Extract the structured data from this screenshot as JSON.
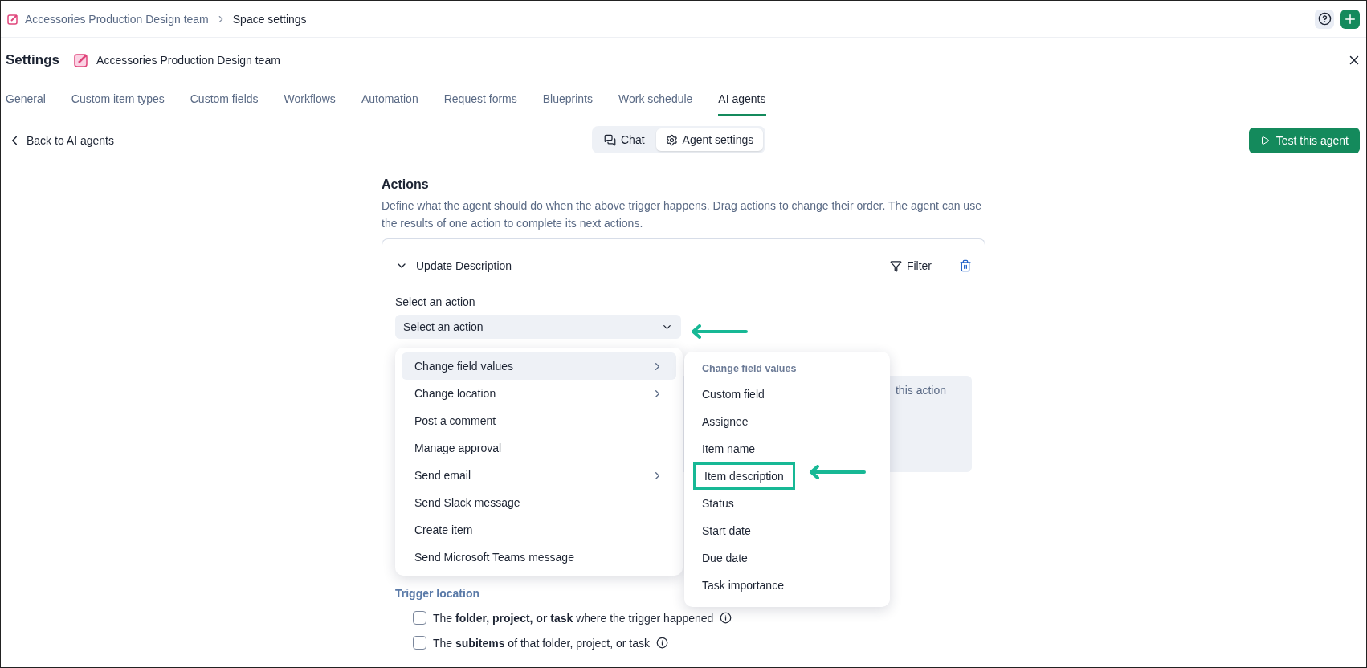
{
  "breadcrumb": [
    {
      "label": "Accessories Production Design team",
      "kind": "link"
    },
    {
      "label": "Space settings",
      "kind": "current"
    }
  ],
  "header": {
    "title": "Settings",
    "space_name": "Accessories Production Design team"
  },
  "tabs": [
    {
      "label": "General",
      "selected": false
    },
    {
      "label": "Custom item types",
      "selected": false
    },
    {
      "label": "Custom fields",
      "selected": false
    },
    {
      "label": "Workflows",
      "selected": false
    },
    {
      "label": "Automation",
      "selected": false
    },
    {
      "label": "Request forms",
      "selected": false
    },
    {
      "label": "Blueprints",
      "selected": false
    },
    {
      "label": "Work schedule",
      "selected": false
    },
    {
      "label": "AI agents",
      "selected": true
    }
  ],
  "back_link": "Back to AI agents",
  "view_toggle": [
    {
      "label": "Chat",
      "kind": "chat",
      "selected": false
    },
    {
      "label": "Agent settings",
      "kind": "settings",
      "selected": true
    }
  ],
  "test_button": "Test this agent",
  "actions": {
    "title": "Actions",
    "description": "Define what the agent should do when the above trigger happens. Drag actions to change their order. The agent can use the results of one action to complete its next actions.",
    "card": {
      "title": "Update Description",
      "expanded": true,
      "filter_label": "Filter",
      "field_label": "Select an action",
      "select_placeholder": "Select an action",
      "note_fragment": "this action",
      "trigger_location_title": "Trigger location",
      "trigger_options": [
        {
          "text": "The **folder, project, or task** where the trigger happened",
          "checked": false
        },
        {
          "text": "The **subitems** of that folder, project, or task",
          "checked": false
        }
      ]
    }
  },
  "action_menu": [
    {
      "label": "Change field values",
      "has_submenu": true,
      "selected": true
    },
    {
      "label": "Change location",
      "has_submenu": true,
      "selected": false
    },
    {
      "label": "Post a comment",
      "has_submenu": false,
      "selected": false
    },
    {
      "label": "Manage approval",
      "has_submenu": false,
      "selected": false
    },
    {
      "label": "Send email",
      "has_submenu": true,
      "selected": false
    },
    {
      "label": "Send Slack message",
      "has_submenu": false,
      "selected": false
    },
    {
      "label": "Create item",
      "has_submenu": false,
      "selected": false
    },
    {
      "label": "Send Microsoft Teams message",
      "has_submenu": false,
      "selected": false
    }
  ],
  "submenu": {
    "heading": "Change field values",
    "items": [
      {
        "label": "Custom field",
        "highlighted": false
      },
      {
        "label": "Assignee",
        "highlighted": false
      },
      {
        "label": "Item name",
        "highlighted": false
      },
      {
        "label": "Item description",
        "highlighted": true
      },
      {
        "label": "Status",
        "highlighted": false
      },
      {
        "label": "Start date",
        "highlighted": false
      },
      {
        "label": "Due date",
        "highlighted": false
      },
      {
        "label": "Task importance",
        "highlighted": false
      }
    ]
  }
}
